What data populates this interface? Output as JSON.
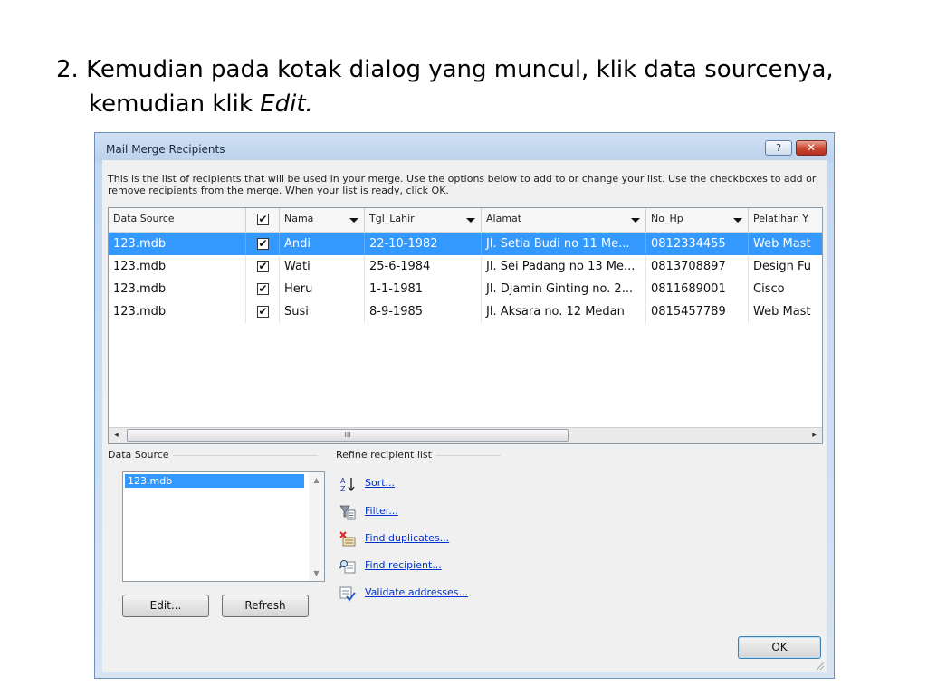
{
  "slide": {
    "line1": "2. Kemudian pada kotak dialog yang muncul, klik data sourcenya,",
    "line2_prefix": "kemudian klik ",
    "line2_italic": "Edit."
  },
  "dialog": {
    "title": "Mail Merge Recipients",
    "help_label": "?",
    "close_label": "✕",
    "description": "This is the list of recipients that will be used in your merge.  Use the options below to add to or change your list.  Use the checkboxes to add or remove recipients from the merge.  When your list is ready, click OK.",
    "columns": [
      "Data Source",
      "",
      "Nama",
      "Tgl_Lahir",
      "Alamat",
      "No_Hp",
      "Pelatihan Y"
    ],
    "rows": [
      {
        "source": "123.mdb",
        "checked": true,
        "nama": "Andi",
        "tgl": "22-10-1982",
        "alamat": "Jl. Setia Budi no 11 Me...",
        "hp": "0812334455",
        "pelatihan": "Web Mast",
        "selected": true
      },
      {
        "source": "123.mdb",
        "checked": true,
        "nama": "Wati",
        "tgl": "25-6-1984",
        "alamat": "Jl. Sei Padang no 13 Me...",
        "hp": "0813708897",
        "pelatihan": "Design Fu",
        "selected": false
      },
      {
        "source": "123.mdb",
        "checked": true,
        "nama": "Heru",
        "tgl": "1-1-1981",
        "alamat": "Jl. Djamin Ginting no. 2...",
        "hp": "0811689001",
        "pelatihan": "Cisco",
        "selected": false
      },
      {
        "source": "123.mdb",
        "checked": true,
        "nama": "Susi",
        "tgl": "8-9-1985",
        "alamat": "Jl. Aksara no. 12 Medan",
        "hp": "0815457789",
        "pelatihan": "Web Mast",
        "selected": false
      }
    ],
    "scroll_left": "◂",
    "scroll_right": "▸",
    "scroll_thumb": "III",
    "data_source_group": "Data Source",
    "data_source_items": [
      "123.mdb"
    ],
    "refine_group": "Refine recipient list",
    "refine_links": {
      "sort": "Sort...",
      "filter": "Filter...",
      "duplicates": "Find duplicates...",
      "recipient": "Find recipient...",
      "validate": "Validate addresses..."
    },
    "edit_button": "Edit...",
    "refresh_button": "Refresh",
    "ok_button": "OK"
  }
}
